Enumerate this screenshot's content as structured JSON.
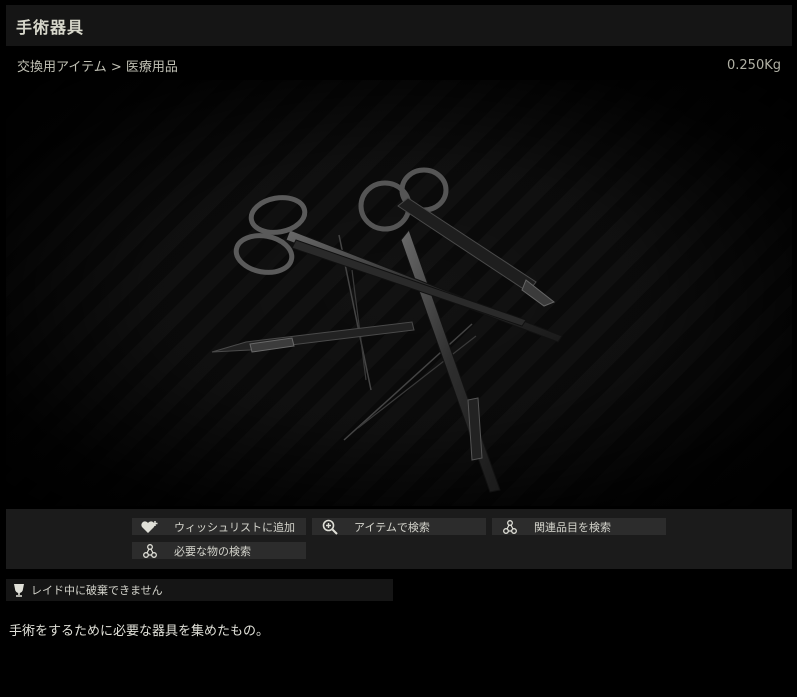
{
  "header": {
    "title": "手術器具"
  },
  "breadcrumb": {
    "category": "交換用アイテム",
    "separator": ">",
    "subcategory": "医療用品"
  },
  "item": {
    "weight": "0.250Kg"
  },
  "actions": {
    "wishlist": {
      "label": "ウィッシュリストに追加",
      "icon": "heart-plus-icon"
    },
    "search_by_item": {
      "label": "アイテムで検索",
      "icon": "magnifier-plus-icon"
    },
    "search_related": {
      "label": "関連品目を検索",
      "icon": "nodes-icon"
    },
    "search_required": {
      "label": "必要な物の検索",
      "icon": "nodes-icon"
    }
  },
  "warning": {
    "text": "レイド中に破棄できません",
    "icon": "goblet-icon"
  },
  "description": "手術をするために必要な器具を集めたもの。",
  "colors": {
    "background": "#000000",
    "panel": "#1b1b1b",
    "button": "#2c2c2c",
    "text": "#c8c8c0"
  }
}
